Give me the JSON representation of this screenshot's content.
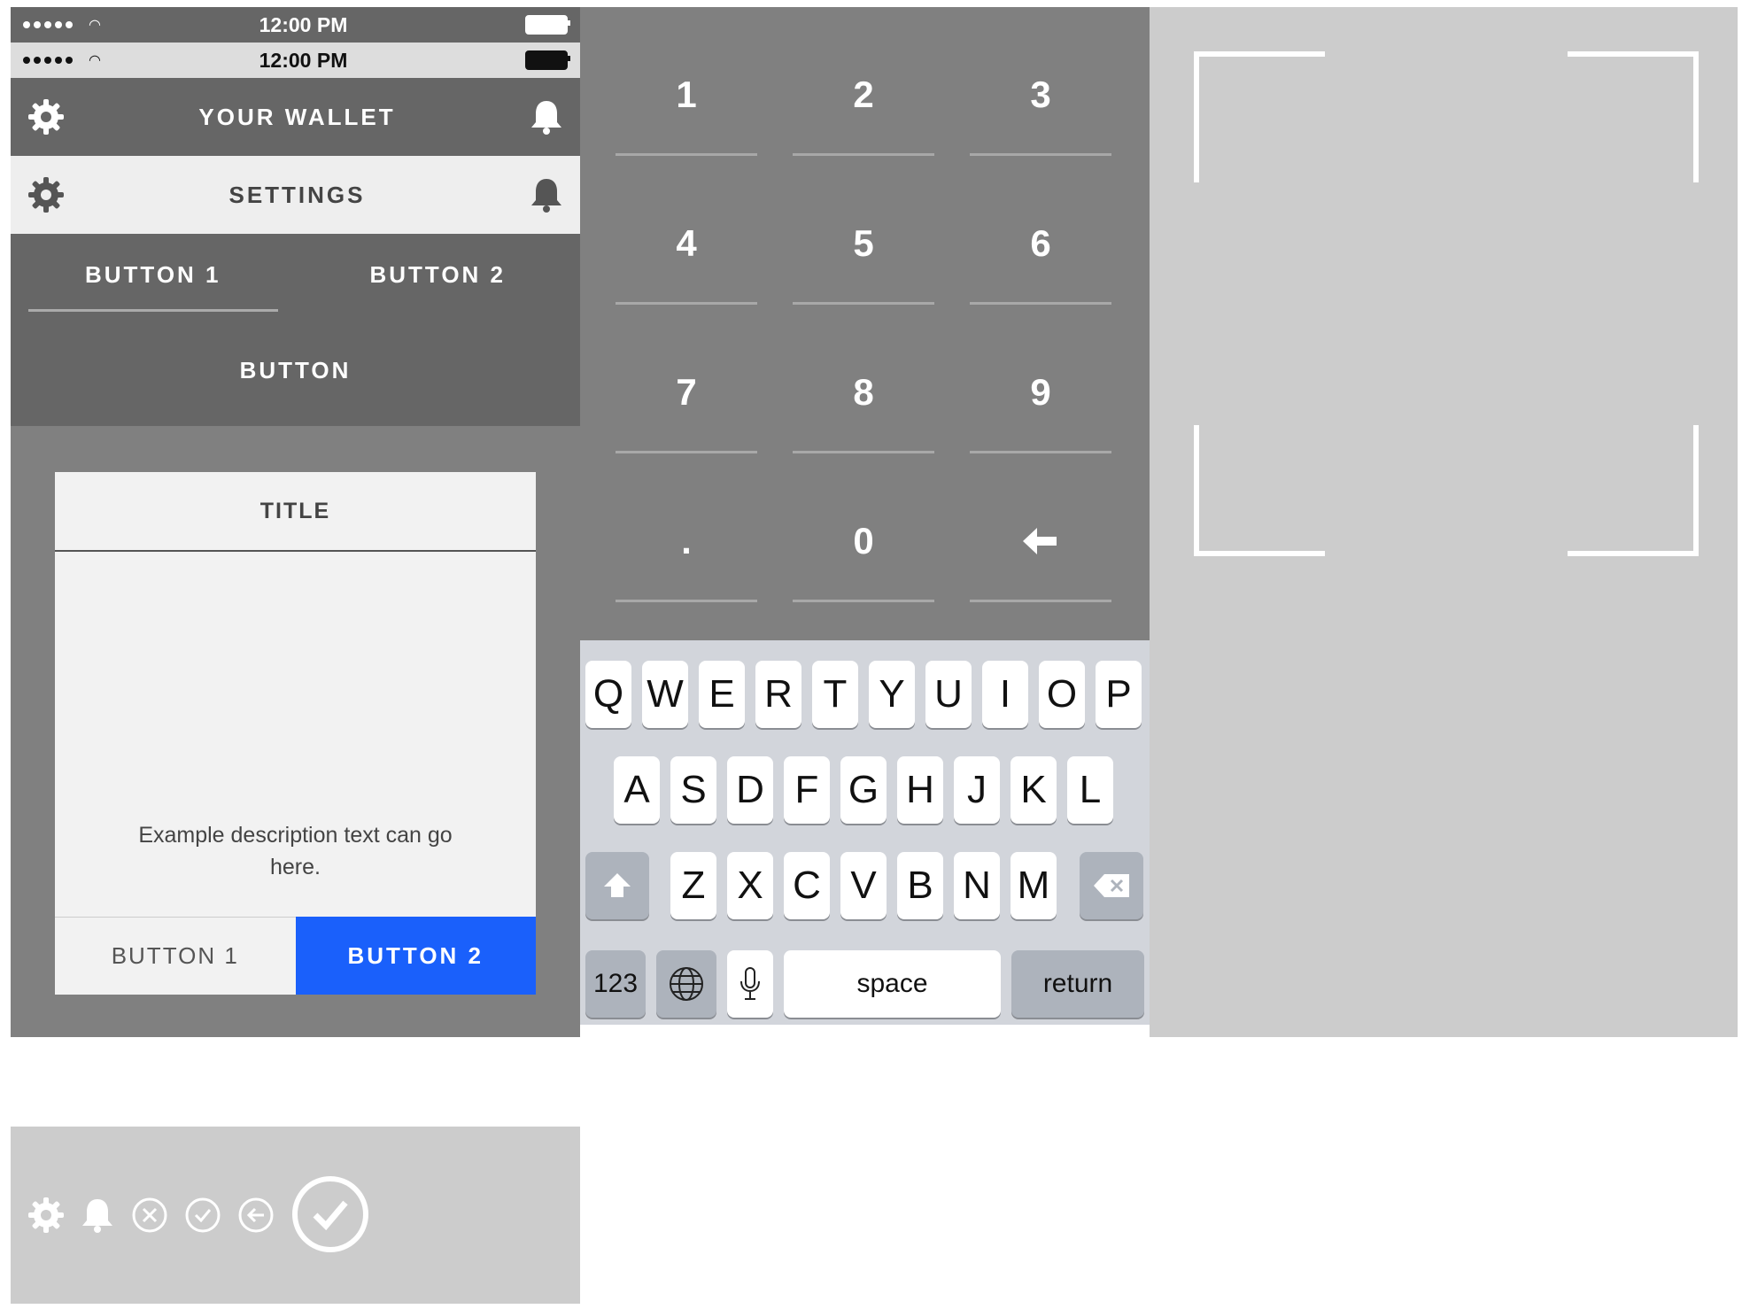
{
  "colors": {
    "dark_gray": "#666666",
    "mid_gray": "#808080",
    "light_gray": "#cccccc",
    "primary_blue": "#1a60fb"
  },
  "status_bars": [
    {
      "time": "12:00 PM",
      "theme": "dark"
    },
    {
      "time": "12:00 PM",
      "theme": "light"
    }
  ],
  "nav_bars": [
    {
      "title": "YOUR WALLET",
      "left_icon": "gear-icon",
      "right_icon": "bell-icon",
      "theme": "dark"
    },
    {
      "title": "SETTINGS",
      "left_icon": "gear-icon",
      "right_icon": "bell-icon",
      "theme": "light"
    }
  ],
  "tabs": {
    "items": [
      "BUTTON 1",
      "BUTTON 2"
    ],
    "active_index": 0
  },
  "plain_button": {
    "label": "BUTTON"
  },
  "dialog": {
    "title": "TITLE",
    "description": "Example description text can go here.",
    "buttons": [
      "BUTTON 1",
      "BUTTON 2"
    ]
  },
  "keypad": {
    "keys": [
      "1",
      "2",
      "3",
      "4",
      "5",
      "6",
      "7",
      "8",
      "9",
      ".",
      "0",
      "backspace-arrow-icon"
    ]
  },
  "keyboard": {
    "row1": [
      "Q",
      "W",
      "E",
      "R",
      "T",
      "Y",
      "U",
      "I",
      "O",
      "P"
    ],
    "row2": [
      "A",
      "S",
      "D",
      "F",
      "G",
      "H",
      "J",
      "K",
      "L"
    ],
    "row3": [
      "Z",
      "X",
      "C",
      "V",
      "B",
      "N",
      "M"
    ],
    "numbers_key": "123",
    "globe_icon": "globe-icon",
    "mic_icon": "microphone-icon",
    "space_key": "space",
    "return_key": "return",
    "shift_icon": "shift-icon",
    "delete_icon": "delete-icon"
  },
  "icon_strip": [
    "gear-icon",
    "bell-icon",
    "close-circle-icon",
    "check-circle-icon",
    "back-arrow-circle-icon",
    "check-circle-large-icon"
  ]
}
